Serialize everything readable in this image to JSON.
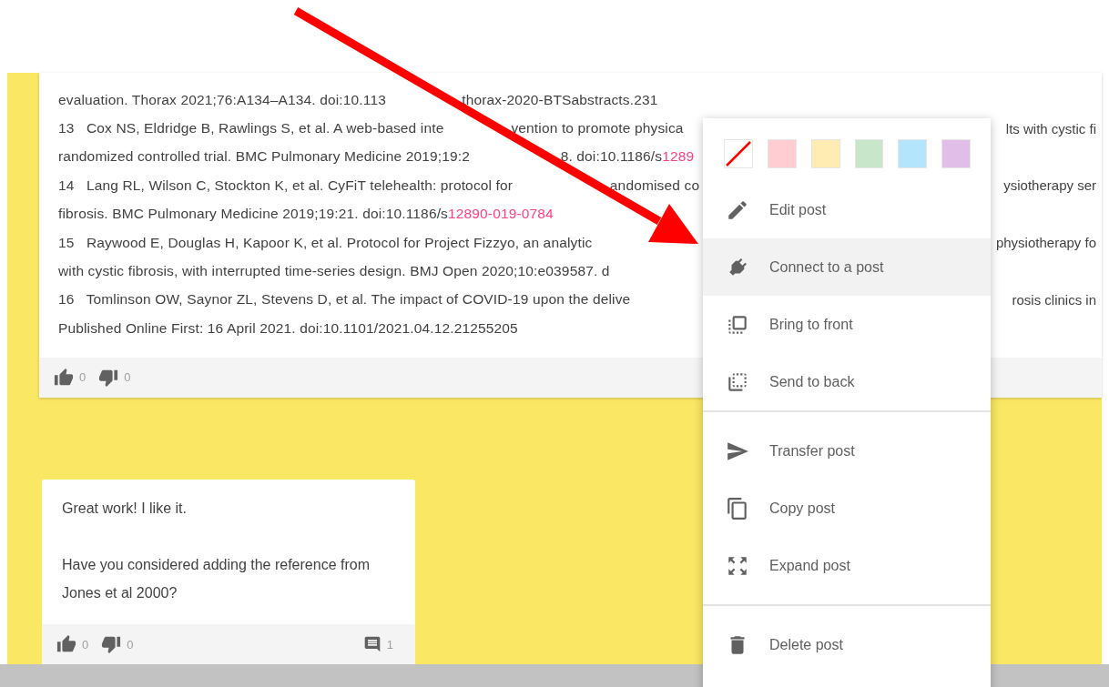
{
  "post": {
    "reference_lines": [
      {
        "before": [
          {
            "text": "evaluation. Thorax 2021;76:A134–A134. doi:10.113"
          }
        ],
        "after": [
          {
            "text": "thorax-2020-BTSabstracts.231"
          }
        ]
      },
      {
        "before": [
          {
            "text": "13   Cox NS, Eldridge B, Rawlings S, et al. A web-based inte"
          }
        ],
        "after": [
          {
            "text": "vention to promote physica"
          }
        ],
        "right": "lts with cystic fi"
      },
      {
        "before": [
          {
            "text": "randomized controlled trial. BMC Pulmonary Medicine 2019;19:2"
          }
        ],
        "after": [
          {
            "text": "8. doi:10.1186/s"
          },
          {
            "text": "1289",
            "link": true
          }
        ]
      },
      {
        "before": [
          {
            "text": "14   Lang RL, Wilson C, Stockton K, et al. CyFiT telehealth: protocol for"
          }
        ],
        "after": [
          {
            "text": "andomised co"
          }
        ],
        "right": "ysiotherapy ser"
      },
      {
        "before": [
          {
            "text": "fibrosis. BMC Pulmonary Medicine 2019;19:21. doi:10.1186/s"
          },
          {
            "text": "12890-019-0784",
            "link": true
          }
        ]
      },
      {
        "before": [
          {
            "text": "15   Raywood E, Douglas H, Kapoor K, et al. Protocol for Project Fizzyo, an analytic"
          }
        ],
        "right": "physiotherapy fo"
      },
      {
        "before": [
          {
            "text": "with cystic fibrosis, with interrupted time-series design. BMJ Open 2020;10:e039587. d"
          }
        ]
      },
      {
        "before": [
          {
            "text": "16   Tomlinson OW, Saynor ZL, Stevens D, et al. The impact of COVID-19 upon the delive"
          }
        ],
        "right": "rosis clinics in"
      },
      {
        "before": [
          {
            "text": "Published Online First: 16 April 2021. doi:10.1101/2021.04.12.21255205"
          }
        ]
      }
    ],
    "likes": "0",
    "dislikes": "0"
  },
  "comment": {
    "paragraphs": [
      "Great work! I like it.",
      "Have you considered adding the reference from Jones et al 2000?"
    ],
    "likes": "0",
    "dislikes": "0",
    "comments": "1"
  },
  "menu": {
    "swatches": [
      {
        "kind": "none"
      },
      {
        "kind": "color",
        "color": "#ffcdd2"
      },
      {
        "kind": "color",
        "color": "#ffecb3"
      },
      {
        "kind": "color",
        "color": "#c8e6c9"
      },
      {
        "kind": "color",
        "color": "#b3e5fc"
      },
      {
        "kind": "color",
        "color": "#e1bee7"
      }
    ],
    "sections": [
      [
        {
          "label": "Edit post",
          "selected": false
        },
        {
          "label": "Connect to a post",
          "selected": true
        },
        {
          "label": "Bring to front",
          "selected": false
        },
        {
          "label": "Send to back",
          "selected": false
        }
      ],
      [
        {
          "label": "Transfer post",
          "selected": false
        },
        {
          "label": "Copy post",
          "selected": false
        },
        {
          "label": "Expand post",
          "selected": false
        }
      ],
      [
        {
          "label": "Delete post",
          "selected": false
        }
      ]
    ]
  }
}
